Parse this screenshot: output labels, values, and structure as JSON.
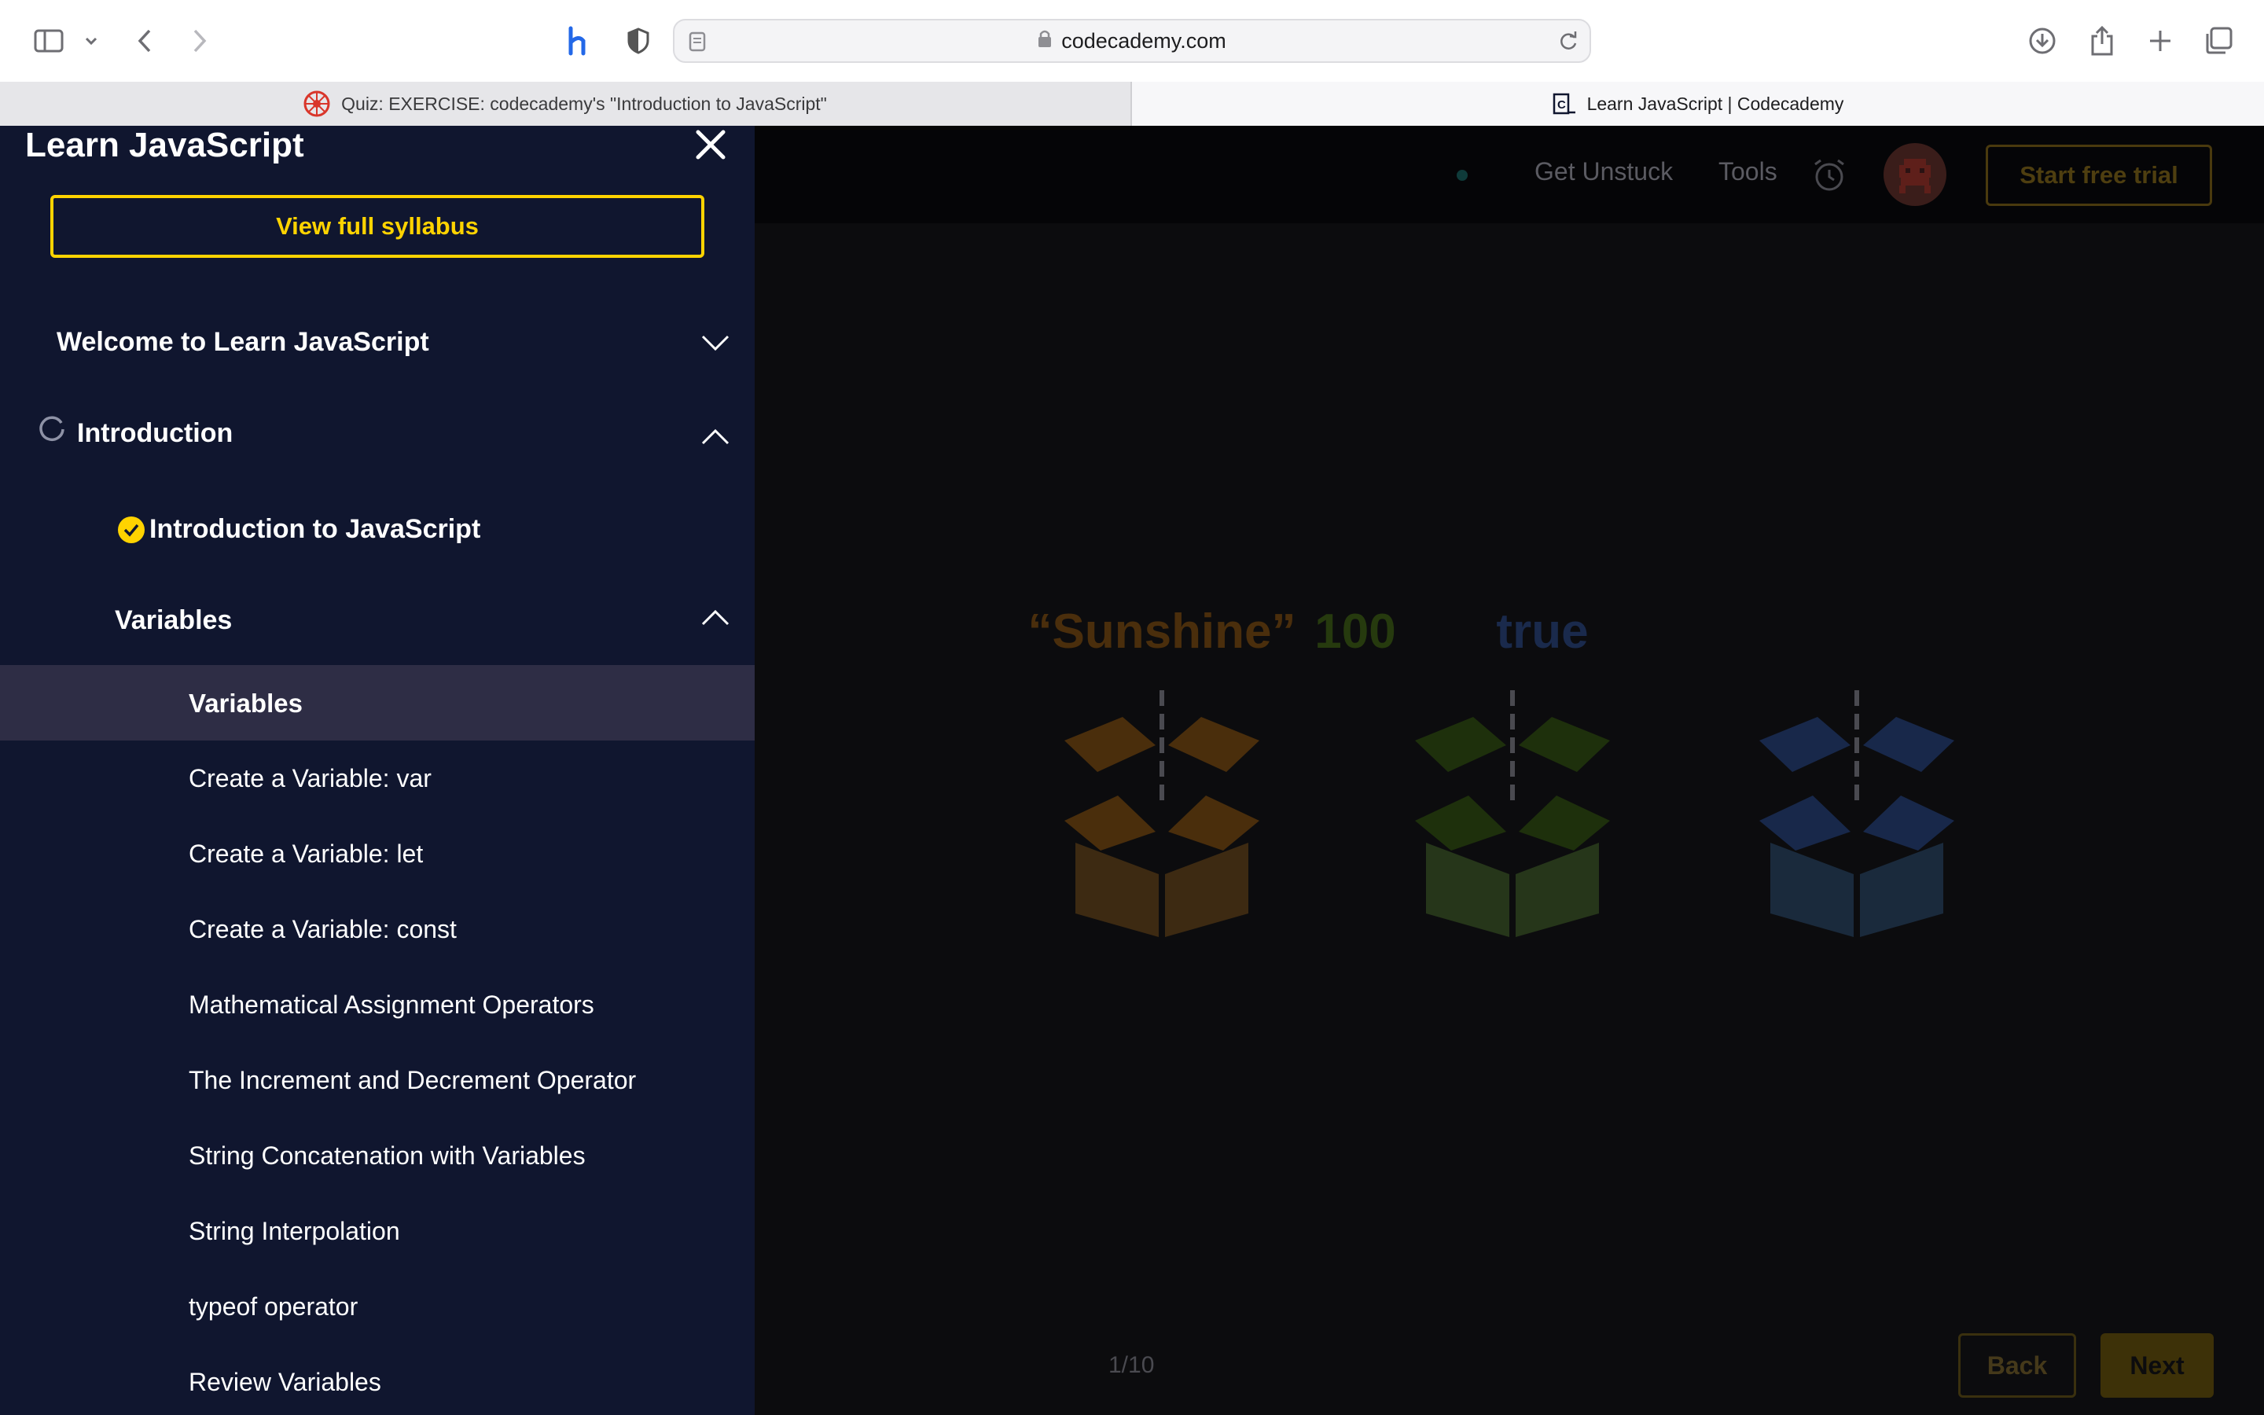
{
  "browser": {
    "url": "codecademy.com",
    "tabs": [
      {
        "label": "Quiz: EXERCISE: codecademy's \"Introduction to JavaScript\""
      },
      {
        "label": "Learn JavaScript | Codecademy"
      }
    ]
  },
  "sidebar": {
    "title": "Learn JavaScript",
    "syllabus_label": "View full syllabus",
    "modules": [
      {
        "label": "Welcome to Learn JavaScript"
      },
      {
        "label": "Introduction"
      }
    ],
    "lessons": [
      {
        "label": "Introduction to JavaScript"
      },
      {
        "label": "Variables"
      }
    ],
    "items": [
      {
        "label": "Variables"
      },
      {
        "label": "Create a Variable: var"
      },
      {
        "label": "Create a Variable: let"
      },
      {
        "label": "Create a Variable: const"
      },
      {
        "label": "Mathematical Assignment Operators"
      },
      {
        "label": "The Increment and Decrement Operator"
      },
      {
        "label": "String Concatenation with Variables"
      },
      {
        "label": "String Interpolation"
      },
      {
        "label": "typeof operator"
      },
      {
        "label": "Review Variables"
      }
    ]
  },
  "topnav": {
    "get_unstuck": "Get Unstuck",
    "tools": "Tools",
    "trial_label": "Start free trial"
  },
  "illustration": {
    "values": [
      {
        "text": "“Sunshine”",
        "color": "#4a2e0c"
      },
      {
        "text": "100",
        "color": "#263a0e"
      },
      {
        "text": "true",
        "color": "#1a2a4c"
      }
    ]
  },
  "footer": {
    "pager": "1/10",
    "back_label": "Back",
    "next_label": "Next"
  },
  "colors": {
    "accent": "#ffd300",
    "sidebar_bg": "#10162f",
    "active_item_bg": "#2e2d45"
  }
}
